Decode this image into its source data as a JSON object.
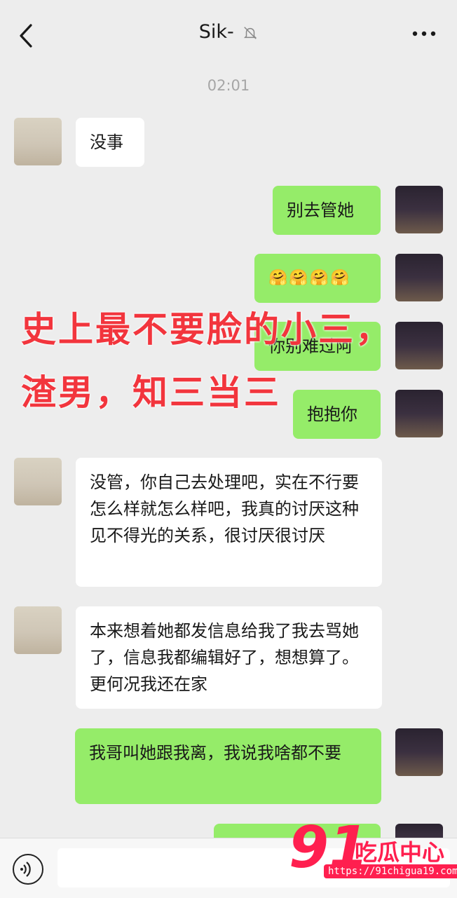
{
  "header": {
    "title": "Sik-",
    "muted_icon": "bell-off-icon",
    "back_icon": "chevron-left-icon",
    "more_icon": "ellipsis-icon"
  },
  "timestamp": "02:01",
  "messages": [
    {
      "side": "left",
      "text": "没事"
    },
    {
      "side": "right",
      "text": "别去管她"
    },
    {
      "side": "right",
      "text": "🤗🤗🤗🤗"
    },
    {
      "side": "right",
      "text": "你别难过阿"
    },
    {
      "side": "right",
      "text": "抱抱你"
    },
    {
      "side": "left",
      "text": "没管，你自己去处理吧，实在不行要怎么样就怎么样吧，我真的讨厌这种见不得光的关系，很讨厌很讨厌"
    },
    {
      "side": "left",
      "text": "本来想着她都发信息给我了我去骂她了，信息我都编辑好了，想想算了。更何况我还在家"
    },
    {
      "side": "right",
      "text": "我哥叫她跟我离，我说我啥都不要"
    }
  ],
  "overlay": {
    "line1": "史上最不要脸的小三，",
    "line2": "渣男，知三当三"
  },
  "watermark": {
    "number": "91",
    "name": "吃瓜中心",
    "url": "https://91chigua19.com"
  },
  "composer": {
    "voice_icon": "voice-icon"
  },
  "colors": {
    "background": "#ededed",
    "bubble_self": "#95ec69",
    "bubble_other": "#ffffff",
    "overlay_text": "#f2353d",
    "watermark": "#ff1f4f"
  }
}
